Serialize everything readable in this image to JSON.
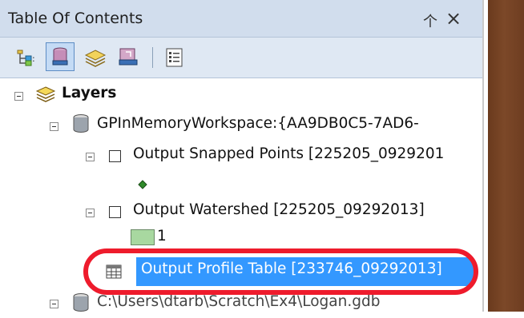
{
  "panel": {
    "title": "Table Of Contents",
    "pin_icon": "pin-icon",
    "close_icon": "close-icon"
  },
  "toolbar": {
    "buttons": [
      {
        "name": "list-by-drawing-order",
        "icon": "drawing-order-icon"
      },
      {
        "name": "list-by-source",
        "icon": "database-icon",
        "selected": true
      },
      {
        "name": "list-by-visibility",
        "icon": "layers-visibility-icon"
      },
      {
        "name": "list-by-selection",
        "icon": "selection-icon"
      },
      {
        "name": "options",
        "icon": "options-list-icon"
      }
    ]
  },
  "tree": {
    "layers_label": "Layers",
    "workspace_label": "GPInMemoryWorkspace:{AA9DB0C5-7AD6-",
    "snapped_points_label": "Output Snapped Points [225205_0929201",
    "watershed_label": "Output Watershed [225205_09292013]",
    "watershed_legend_value": "1",
    "profile_table_label": "Output Profile Table [233746_09292013]",
    "partial_path_label": "C:\\Users\\dtarb\\Scratch\\Ex4\\Logan.gdb"
  },
  "colors": {
    "selection": "#3398ff",
    "annotation": "#ee1b2c",
    "title_bar": "#d1dded",
    "watershed_fill": "#a8d8a0"
  }
}
